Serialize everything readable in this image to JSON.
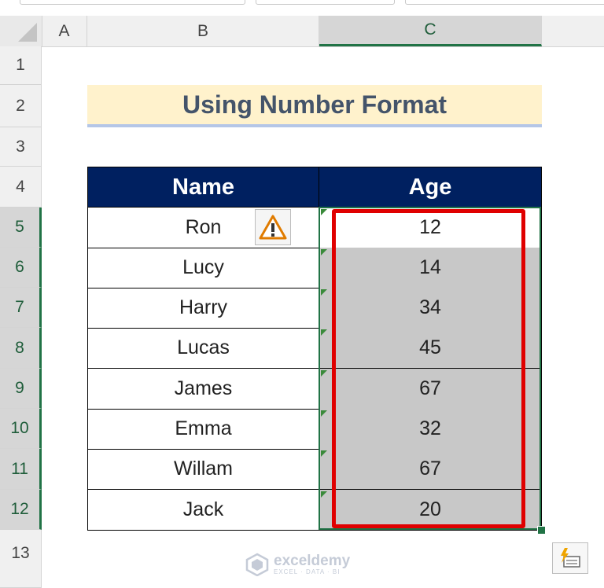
{
  "columns": [
    "A",
    "B",
    "C"
  ],
  "rows": [
    "1",
    "2",
    "3",
    "4",
    "5",
    "6",
    "7",
    "8",
    "9",
    "10",
    "11",
    "12",
    "13"
  ],
  "title": "Using Number Format",
  "table": {
    "headers": [
      "Name",
      "Age"
    ],
    "rows": [
      {
        "name": "Ron",
        "age": "12"
      },
      {
        "name": "Lucy",
        "age": "14"
      },
      {
        "name": "Harry",
        "age": "34"
      },
      {
        "name": "Lucas",
        "age": "45"
      },
      {
        "name": "James",
        "age": "67"
      },
      {
        "name": "Emma",
        "age": "32"
      },
      {
        "name": "Willam",
        "age": "67"
      },
      {
        "name": "Jack",
        "age": "20"
      }
    ]
  },
  "watermark": {
    "brand": "exceldemy",
    "tagline": "EXCEL · DATA · BI"
  },
  "colors": {
    "header_fill": "#002060",
    "title_fill": "#fff2cc",
    "selection": "#217346",
    "highlight": "#e00000",
    "age_fill": "#c8c8c8"
  },
  "icons": {
    "warning": "warning-icon",
    "quick_analysis": "quick-analysis-icon"
  }
}
